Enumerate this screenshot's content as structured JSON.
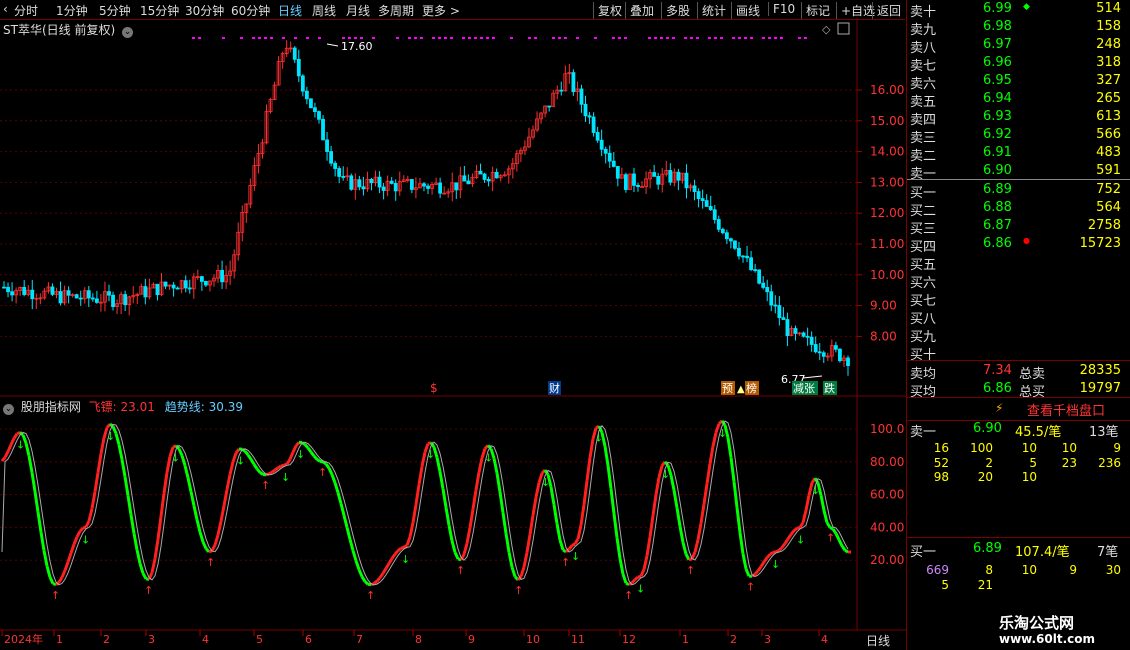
{
  "toolbar": {
    "periods": [
      "分时",
      "1分钟",
      "5分钟",
      "15分钟",
      "30分钟",
      "60分钟",
      "日线",
      "周线",
      "月线",
      "多周期",
      "更多 >"
    ],
    "active_period": "日线",
    "actions": [
      "复权",
      "叠加",
      "多股",
      "统计",
      "画线",
      "F10",
      "标记",
      "+自选",
      "返回"
    ]
  },
  "main_chart": {
    "title": "ST萃华(日线 前复权)",
    "price_axis": [
      "16.00",
      "15.00",
      "14.00",
      "13.00",
      "12.00",
      "11.00",
      "10.00",
      "9.00",
      "8.00"
    ],
    "high_label": "17.60",
    "low_label": "6.77",
    "event_markers": [
      "$",
      "财",
      "预",
      "榜",
      "减张",
      "跌"
    ]
  },
  "indicator": {
    "name": "股朋指标网",
    "line1_label": "飞镖:",
    "line1_value": "23.01",
    "line2_label": "趋势线:",
    "line2_value": "30.39",
    "axis": [
      "100.0",
      "80.00",
      "60.00",
      "40.00",
      "20.00"
    ]
  },
  "x_axis": {
    "labels": [
      "2024年",
      "1",
      "2",
      "3",
      "4",
      "5",
      "6",
      "7",
      "8",
      "9",
      "10",
      "11",
      "12",
      "1",
      "2",
      "3",
      "4"
    ],
    "period_label": "日线"
  },
  "chart_data": {
    "type": "candlestick",
    "title": "ST萃华(日线 前复权)",
    "y_range": [
      6.5,
      17.6
    ],
    "approx_price_path": [
      {
        "period": "2024-01",
        "price": 9.6
      },
      {
        "period": "2024-02",
        "price": 9.3
      },
      {
        "period": "2024-03",
        "price": 9.2
      },
      {
        "period": "2024-04",
        "price": 9.7
      },
      {
        "period": "2024-05",
        "price": 10.0
      },
      {
        "period": "2024-06",
        "price": 17.6
      },
      {
        "period": "2024-07",
        "price": 13.0
      },
      {
        "period": "2024-08",
        "price": 12.9
      },
      {
        "period": "2024-09",
        "price": 12.9
      },
      {
        "period": "2024-10",
        "price": 13.5
      },
      {
        "period": "2024-11",
        "price": 16.5
      },
      {
        "period": "2024-12",
        "price": 13.0
      },
      {
        "period": "2025-01",
        "price": 13.2
      },
      {
        "period": "2025-02",
        "price": 11.0
      },
      {
        "period": "2025-03",
        "price": 8.0
      },
      {
        "period": "2025-04",
        "price": 7.3
      }
    ],
    "indicator_series": [
      {
        "name": "飞镖",
        "last": 23.01
      },
      {
        "name": "趋势线",
        "last": 30.39
      }
    ],
    "indicator_range": [
      0,
      110
    ]
  },
  "orderbook": {
    "asks": [
      {
        "label": "卖十",
        "price": "6.99",
        "vol": "514"
      },
      {
        "label": "卖九",
        "price": "6.98",
        "vol": "158"
      },
      {
        "label": "卖八",
        "price": "6.97",
        "vol": "248"
      },
      {
        "label": "卖七",
        "price": "6.96",
        "vol": "318"
      },
      {
        "label": "卖六",
        "price": "6.95",
        "vol": "327"
      },
      {
        "label": "卖五",
        "price": "6.94",
        "vol": "265"
      },
      {
        "label": "卖四",
        "price": "6.93",
        "vol": "613"
      },
      {
        "label": "卖三",
        "price": "6.92",
        "vol": "566"
      },
      {
        "label": "卖二",
        "price": "6.91",
        "vol": "483"
      },
      {
        "label": "卖一",
        "price": "6.90",
        "vol": "591"
      }
    ],
    "bids": [
      {
        "label": "买一",
        "price": "6.89",
        "vol": "752"
      },
      {
        "label": "买二",
        "price": "6.88",
        "vol": "564"
      },
      {
        "label": "买三",
        "price": "6.87",
        "vol": "2758"
      },
      {
        "label": "买四",
        "price": "6.86",
        "vol": "15723"
      },
      {
        "label": "买五",
        "price": "",
        "vol": ""
      },
      {
        "label": "买六",
        "price": "",
        "vol": ""
      },
      {
        "label": "买七",
        "price": "",
        "vol": ""
      },
      {
        "label": "买八",
        "price": "",
        "vol": ""
      },
      {
        "label": "买九",
        "price": "",
        "vol": ""
      },
      {
        "label": "买十",
        "price": "",
        "vol": ""
      }
    ],
    "summary": [
      {
        "label": "卖均",
        "price": "7.34",
        "label2": "总卖",
        "vol": "28335"
      },
      {
        "label": "买均",
        "price": "6.86",
        "label2": "总买",
        "vol": "19797"
      }
    ],
    "view_button": "查看千档盘口",
    "sell1": {
      "label": "卖一",
      "price": "6.90",
      "avg": "45.5/笔",
      "count": "13笔",
      "rows": [
        [
          "16",
          "100",
          "10",
          "10",
          "9"
        ],
        [
          "52",
          "2",
          "5",
          "23",
          "236"
        ],
        [
          "98",
          "20",
          "10",
          "",
          ""
        ]
      ]
    },
    "buy1": {
      "label": "买一",
      "price": "6.89",
      "avg": "107.4/笔",
      "count": "7笔",
      "rows": [
        [
          "669",
          "8",
          "10",
          "9",
          "30"
        ],
        [
          "5",
          "21",
          "",
          "",
          ""
        ]
      ]
    }
  },
  "watermark": {
    "line1": "乐淘公式网",
    "line2": "www.60lt.com"
  },
  "colors": {
    "up": "#ff3030",
    "down": "#00e5ff",
    "grid": "#7a0000",
    "green": "#00ff00",
    "yellow": "#ffff00",
    "magenta": "#ff00ff"
  }
}
